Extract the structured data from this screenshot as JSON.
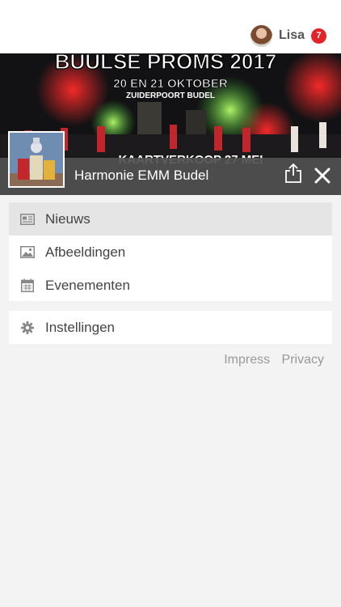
{
  "user": {
    "name": "Lisa",
    "notification_count": "7"
  },
  "banner": {
    "headline": "BUULSE PROMS 2017",
    "date_line": "20 EN 21 OKTOBER",
    "venue_line": "ZUIDERPOORT BUDEL",
    "ticket_line": "KAARTVERKOOP 27 MEI"
  },
  "group": {
    "name": "Harmonie EMM Budel"
  },
  "menu": {
    "items": [
      {
        "label": "Nieuws",
        "icon": "newspaper-icon",
        "active": true
      },
      {
        "label": "Afbeeldingen",
        "icon": "image-icon",
        "active": false
      },
      {
        "label": "Evenementen",
        "icon": "calendar-icon",
        "active": false
      }
    ],
    "settings_label": "Instellingen"
  },
  "footer": {
    "impress": "Impress",
    "privacy": "Privacy"
  },
  "colors": {
    "badge": "#e1252b",
    "infobar": "#505050",
    "active_item": "#e5e5e5",
    "background": "#f3f3f3"
  }
}
